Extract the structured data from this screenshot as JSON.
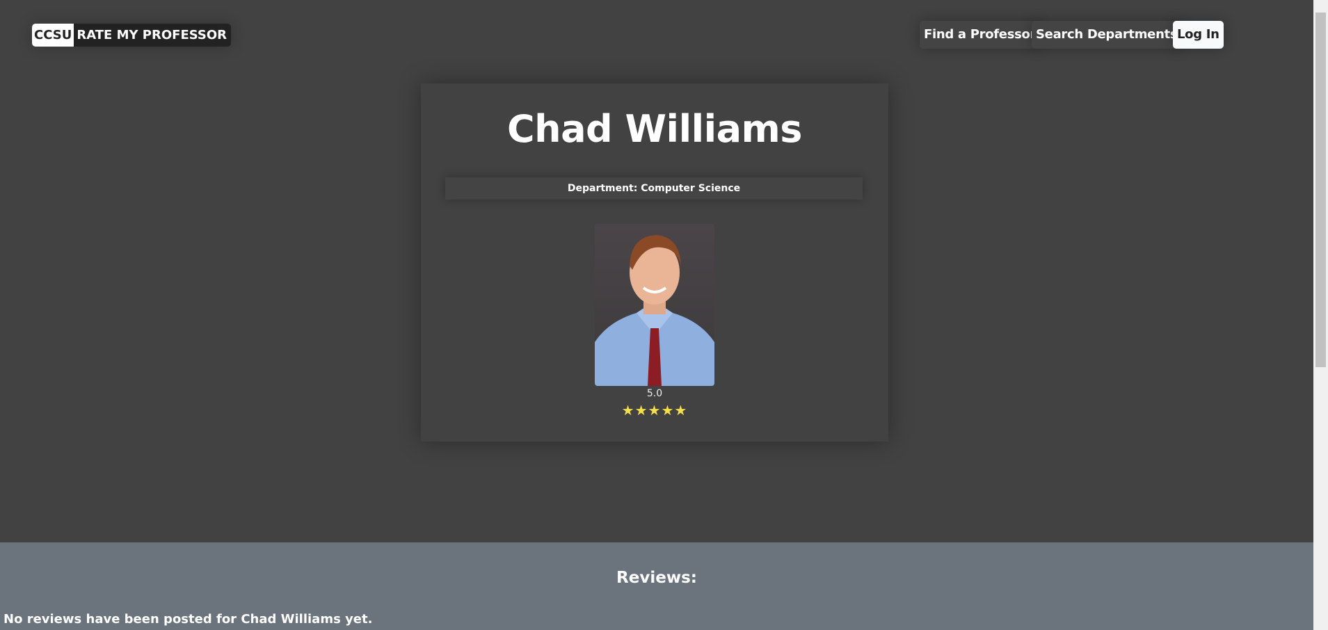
{
  "header": {
    "logo_left": "CCSU",
    "logo_right": "RATE MY PROFESSOR",
    "nav": [
      "Find a Professor",
      "Search Departments"
    ],
    "login": "Log In"
  },
  "professor": {
    "name": "Chad Williams",
    "department": "Department: Computer Science",
    "rating": "5.0",
    "stars": "★★★★★",
    "star_count": 5,
    "star_color": "#f5e04a"
  },
  "reviews": {
    "title": "Reviews:",
    "empty": "No reviews have been posted for Chad Williams yet."
  }
}
